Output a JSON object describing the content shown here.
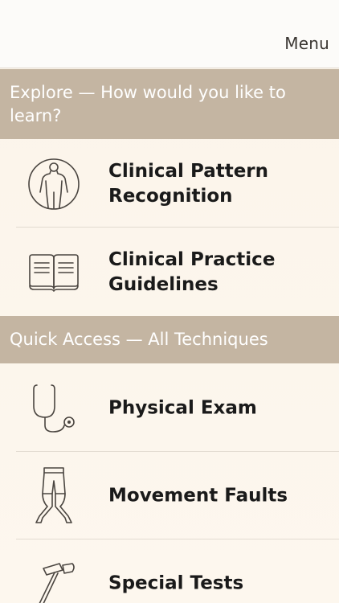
{
  "topbar": {
    "menu_label": "Menu"
  },
  "sections": [
    {
      "title": "Explore — How would you like to learn?",
      "items": [
        {
          "label": "Clinical Pattern Recognition",
          "icon": "body-outline-icon"
        },
        {
          "label": "Clinical Practice Guidelines",
          "icon": "open-book-icon"
        }
      ]
    },
    {
      "title": "Quick Access — All Techniques",
      "items": [
        {
          "label": "Physical Exam",
          "icon": "stethoscope-icon"
        },
        {
          "label": "Movement Faults",
          "icon": "legs-icon"
        },
        {
          "label": "Special Tests",
          "icon": "reflex-hammer-icon"
        }
      ]
    }
  ],
  "colors": {
    "header_bg": "#c4b5a2",
    "background": "#fdf6ec",
    "text": "#1a1a1a",
    "icon_stroke": "#4a4540"
  }
}
